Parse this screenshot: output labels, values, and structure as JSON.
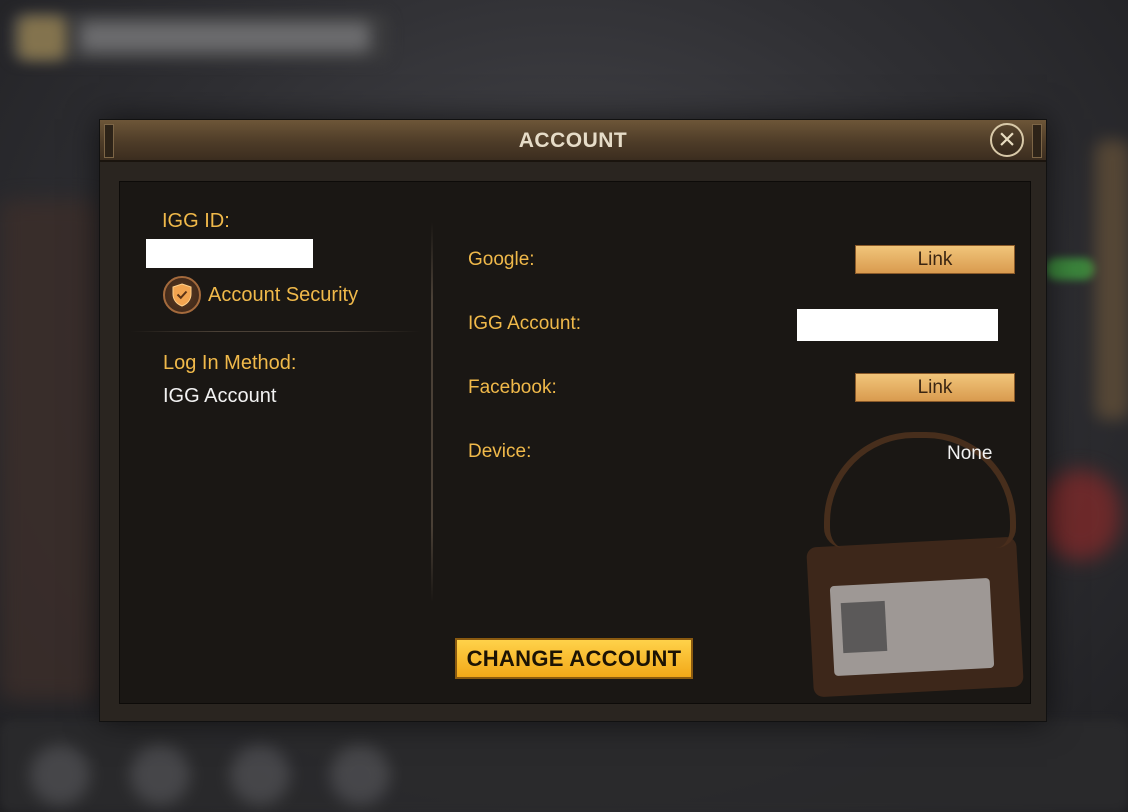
{
  "window": {
    "title": "ACCOUNT"
  },
  "left_panel": {
    "igg_id_label": "IGG ID:",
    "account_security_label": "Account Security",
    "login_method_label": "Log In Method:",
    "login_method_value": "IGG Account"
  },
  "right_panel": {
    "rows": [
      {
        "label": "Google:",
        "action": "Link"
      },
      {
        "label": "IGG Account:"
      },
      {
        "label": "Facebook:",
        "action": "Link"
      },
      {
        "label": "Device:",
        "value": "None"
      }
    ]
  },
  "footer": {
    "change_account_label": "CHANGE ACCOUNT"
  },
  "colors": {
    "gold": "#f0b94a",
    "button_gold": "#f2a818",
    "panel_bg": "#1a1714"
  },
  "icons": {
    "close": "close-x-icon",
    "security": "shield-check-icon"
  }
}
